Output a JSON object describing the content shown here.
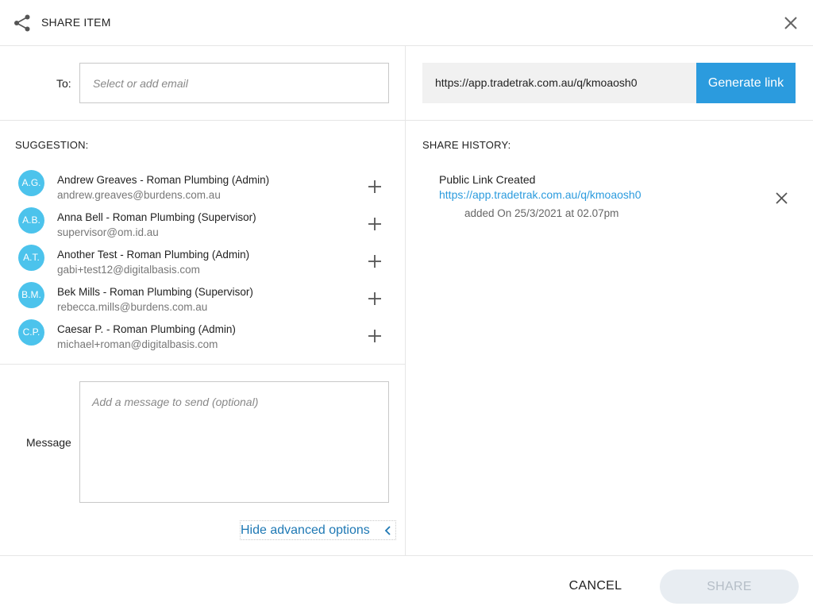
{
  "header": {
    "title": "SHARE ITEM",
    "share_icon": "share-icon",
    "close_icon": "close-icon"
  },
  "recipients": {
    "label": "To:",
    "placeholder": "Select or add email",
    "value": ""
  },
  "public_link": {
    "url": "https://app.tradetrak.com.au/q/kmoaosh0",
    "generate_label": "Generate link"
  },
  "suggestions": {
    "label": "SUGGESTION:",
    "items": [
      {
        "initials": "A.G.",
        "name": "Andrew Greaves - Roman Plumbing (Admin)",
        "email": "andrew.greaves@burdens.com.au"
      },
      {
        "initials": "A.B.",
        "name": "Anna Bell - Roman Plumbing (Supervisor)",
        "email": "supervisor@om.id.au"
      },
      {
        "initials": "A.T.",
        "name": "Another Test - Roman Plumbing (Admin)",
        "email": "gabi+test12@digitalbasis.com"
      },
      {
        "initials": "B.M.",
        "name": "Bek Mills - Roman Plumbing (Supervisor)",
        "email": "rebecca.mills@burdens.com.au"
      },
      {
        "initials": "C.P.",
        "name": "Caesar P. - Roman Plumbing (Admin)",
        "email": "michael+roman@digitalbasis.com"
      }
    ]
  },
  "message": {
    "label": "Message",
    "placeholder": "Add a message to send (optional)"
  },
  "advanced": {
    "label": "Hide advanced options"
  },
  "history": {
    "label": "SHARE HISTORY:",
    "entries": [
      {
        "title": "Public Link Created",
        "url": "https://app.tradetrak.com.au/q/kmoaosh0",
        "date": "added On 25/3/2021 at 02.07pm"
      }
    ]
  },
  "footer": {
    "cancel_label": "CANCEL",
    "share_label": "SHARE"
  },
  "colors": {
    "accent": "#2b9bde",
    "avatar": "#4cc3ec",
    "link": "#1e78b4",
    "share_disabled_bg": "#e8edf2"
  }
}
